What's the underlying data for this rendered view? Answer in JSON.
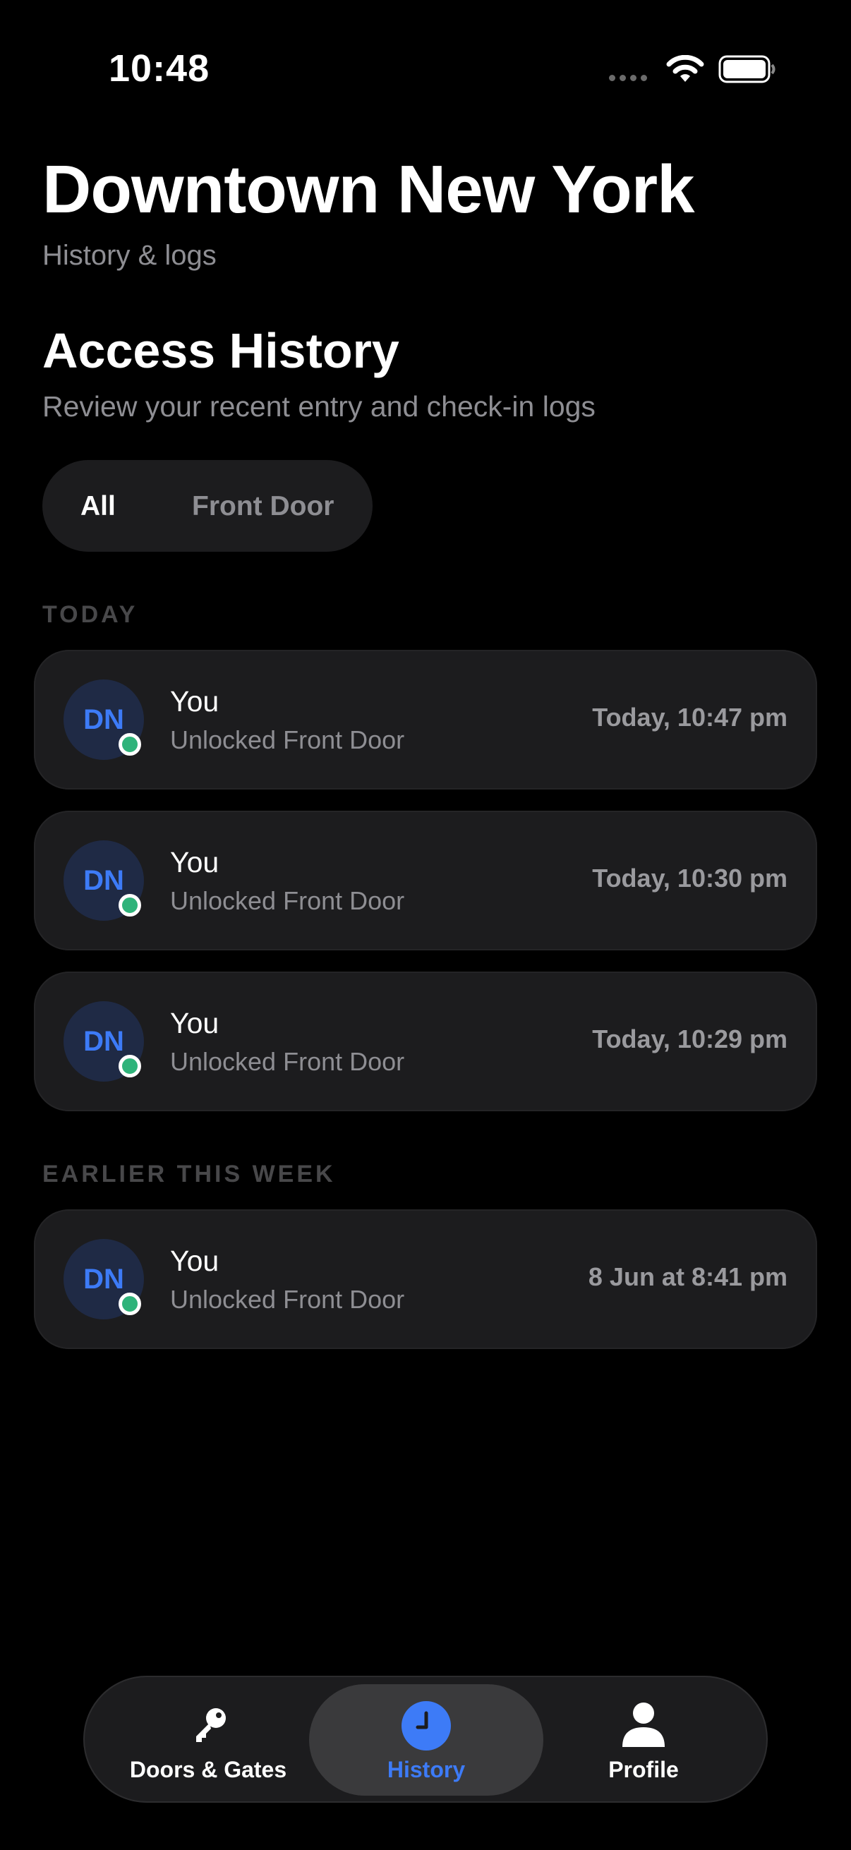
{
  "status_bar": {
    "time": "10:48"
  },
  "header": {
    "title": "Downtown New York",
    "subtitle": "History & logs"
  },
  "section": {
    "title": "Access History",
    "subtitle": "Review your recent entry and check-in logs"
  },
  "filters": {
    "options": [
      "All",
      "Front Door"
    ],
    "selected": "All"
  },
  "groups": [
    {
      "label": "TODAY",
      "entries": [
        {
          "initials": "DN",
          "who": "You",
          "action": "Unlocked Front Door",
          "when": "Today, 10:47 pm"
        },
        {
          "initials": "DN",
          "who": "You",
          "action": "Unlocked Front Door",
          "when": "Today, 10:30 pm"
        },
        {
          "initials": "DN",
          "who": "You",
          "action": "Unlocked Front Door",
          "when": "Today, 10:29 pm"
        }
      ]
    },
    {
      "label": "EARLIER THIS WEEK",
      "entries": [
        {
          "initials": "DN",
          "who": "You",
          "action": "Unlocked Front Door",
          "when": "8 Jun at 8:41 pm"
        }
      ]
    }
  ],
  "tabbar": {
    "tabs": [
      {
        "label": "Doors & Gates",
        "icon": "key-icon"
      },
      {
        "label": "History",
        "icon": "clock-icon"
      },
      {
        "label": "Profile",
        "icon": "person-icon"
      }
    ],
    "active": "History"
  },
  "colors": {
    "accent": "#3d7bf7",
    "online": "#2fb37a",
    "card": "#1c1c1e"
  }
}
